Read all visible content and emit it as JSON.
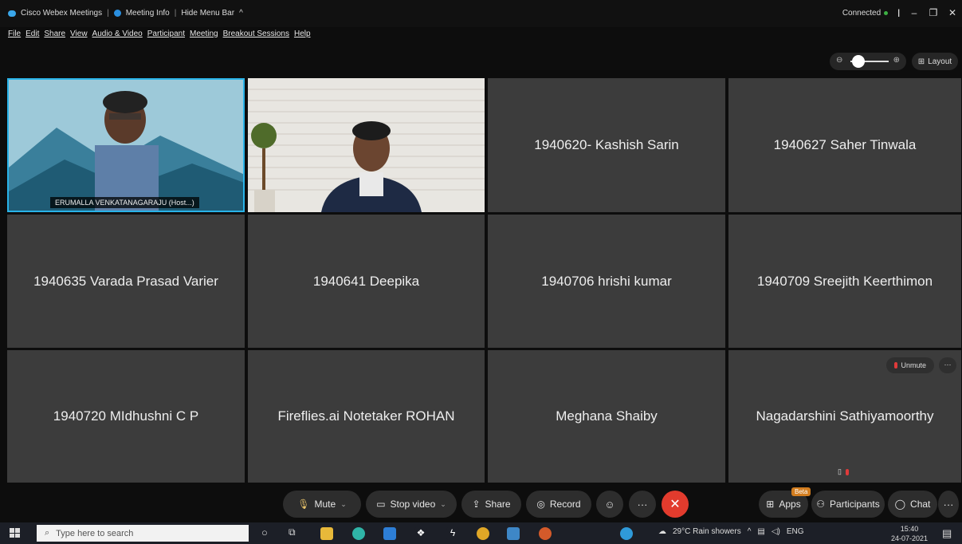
{
  "titlebar": {
    "app_name": "Cisco Webex Meetings",
    "meeting_info": "Meeting Info",
    "hide_menu_bar": "Hide Menu Bar",
    "status": "Connected"
  },
  "menu": [
    "File",
    "Edit",
    "Share",
    "View",
    "Audio & Video",
    "Participant",
    "Meeting",
    "Breakout Sessions",
    "Help"
  ],
  "layout_label": "Layout",
  "zoom_level": 0.2,
  "host_label": "ERUMALLA VENKATANAGARAJU  (Host...)",
  "participants": [
    "1940620- Kashish Sarin",
    "1940627 Saher Tinwala",
    "1940635 Varada Prasad Varier",
    "1940641 Deepika",
    "1940706 hrishi kumar",
    "1940709 Sreejith Keerthimon",
    "1940720 MIdhushni C P",
    "Fireflies.ai Notetaker ROHAN",
    "Meghana Shaiby",
    "Nagadarshini Sathiyamoorthy"
  ],
  "tile_controls": {
    "unmute": "Unmute",
    "more": "···"
  },
  "controls": {
    "mute": "Mute",
    "stop_video": "Stop video",
    "share": "Share",
    "record": "Record",
    "apps": "Apps",
    "beta": "Beta",
    "participants": "Participants",
    "chat": "Chat"
  },
  "taskbar": {
    "search_placeholder": "Type here to search",
    "weather": "29°C  Rain showers",
    "lang": "ENG",
    "time": "15:40",
    "date": "24-07-2021"
  },
  "colors": {
    "active_border": "#29b3e8",
    "leave": "#e23b2d",
    "tile_bg": "#3c3c3c"
  }
}
